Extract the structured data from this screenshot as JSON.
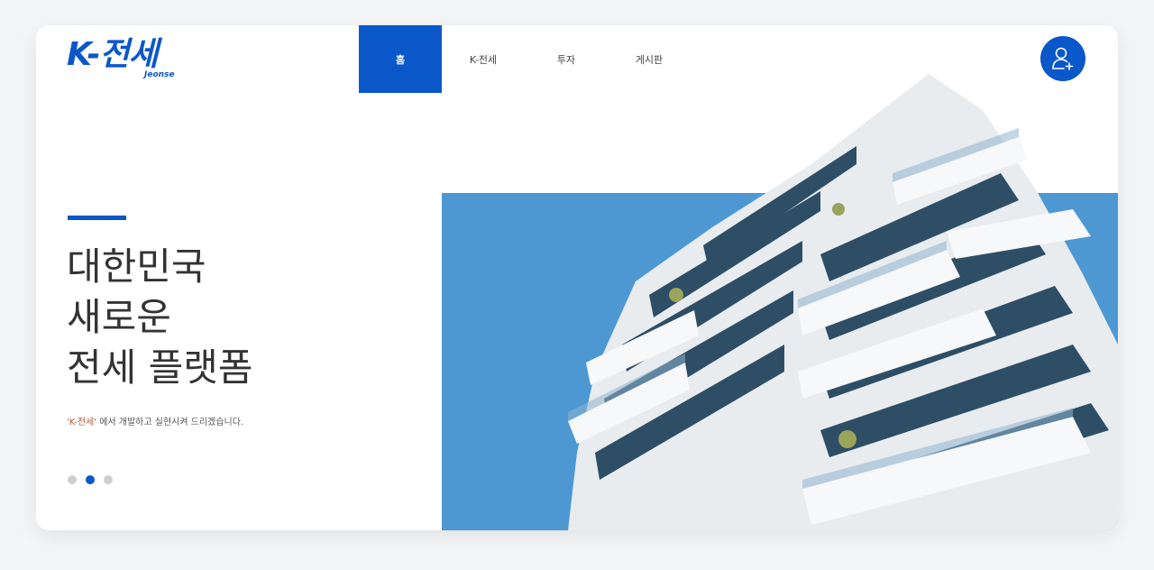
{
  "logo": {
    "main": "K-전세",
    "sub": "Jeonse"
  },
  "nav": {
    "items": [
      {
        "label": "홈",
        "active": true
      },
      {
        "label": "K-전세",
        "active": false
      },
      {
        "label": "투자",
        "active": false
      },
      {
        "label": "게시판",
        "active": false
      }
    ]
  },
  "user_button": {
    "icon": "user-add-icon"
  },
  "hero": {
    "title_lines": [
      "대한민국",
      "새로운",
      "전세 플랫폼"
    ],
    "subtitle_quoted": "'K-전세'",
    "subtitle_rest": " 에서 개발하고 실현시켜 드리겠습니다.",
    "slides": {
      "count": 3,
      "active_index": 1
    }
  },
  "colors": {
    "brand": "#0a57c9",
    "image_background": "#4d98d3",
    "dot_inactive": "#cfcfcf"
  }
}
